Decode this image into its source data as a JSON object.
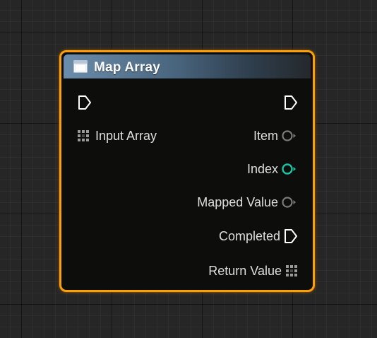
{
  "node": {
    "title": "Map Array",
    "header_icon": "function-window-icon",
    "inputs": [
      {
        "label": "",
        "type": "exec",
        "icon": "exec-pin-icon"
      },
      {
        "label": "Input Array",
        "type": "array",
        "icon": "array-grid-icon"
      }
    ],
    "outputs": [
      {
        "label": "",
        "type": "exec",
        "icon": "exec-pin-icon"
      },
      {
        "label": "Item",
        "type": "wildcard",
        "icon": "data-pin-icon"
      },
      {
        "label": "Index",
        "type": "integer",
        "icon": "data-pin-icon"
      },
      {
        "label": "Mapped Value",
        "type": "wildcard",
        "icon": "data-pin-icon"
      },
      {
        "label": "Completed",
        "type": "exec",
        "icon": "exec-pin-icon"
      },
      {
        "label": "Return Value",
        "type": "array",
        "icon": "array-grid-icon"
      }
    ]
  },
  "colors": {
    "node_border": "#f7a20d",
    "node_body": "#0d0d0c",
    "header_gradient_start": "#6b8dab",
    "index_pin": "#1ec4a0",
    "wildcard_pin": "#7a7a7a",
    "canvas_background": "#262626"
  }
}
